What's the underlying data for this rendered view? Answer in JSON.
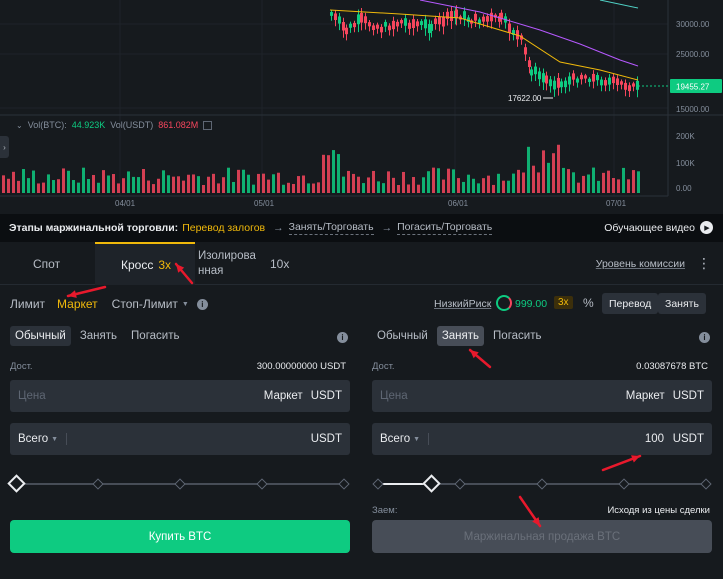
{
  "chart": {
    "price_axis": [
      "30000.00",
      "25000.00",
      "15000.00"
    ],
    "current_price": "19455.27",
    "low_label": "17622.00",
    "volume_axis": [
      "200K",
      "100K",
      "0.00"
    ],
    "date_labels": [
      "04/01",
      "05/01",
      "06/01",
      "07/01"
    ],
    "vol_legend": {
      "label": "Vol(BTC):",
      "btc": "44.923K",
      "usdt_label": "Vol(USDT)",
      "usdt": "861.082M"
    },
    "colors": {
      "up": "#0ecb81",
      "down": "#f6465d",
      "ma_fast": "#f0b90b",
      "ma_slow": "#b659ff"
    }
  },
  "stages": {
    "label": "Этапы маржинальной торговли:",
    "steps": [
      "Перевод залогов",
      "Занять/Торговать",
      "Погасить/Торговать"
    ],
    "video": "Обучающее видео"
  },
  "tabs": {
    "spot": "Спот",
    "cross": "Кросс",
    "cross_leverage": "3x",
    "isolated_line1": "Изолирова",
    "isolated_line2": "нная",
    "isolated_leverage": "10x",
    "fee_level": "Уровень комиссии",
    "more": "⋮"
  },
  "order_types": {
    "limit": "Лимит",
    "market": "Маркет",
    "stop_limit": "Стоп-Лимит",
    "risk": "НизкийРиск",
    "margin_ratio": "999.00",
    "leverage_badge": "3x",
    "transfer": "Перевод",
    "borrow": "Занять"
  },
  "buy_panel": {
    "modes": [
      "Обычный",
      "Занять",
      "Погасить"
    ],
    "available_label": "Дост.",
    "available_value": "300.00000000 USDT",
    "price_placeholder": "Цена",
    "price_market": "Маркет",
    "price_unit": "USDT",
    "total_label": "Всего",
    "total_unit": "USDT",
    "submit": "Купить BTC"
  },
  "sell_panel": {
    "modes": [
      "Обычный",
      "Занять",
      "Погасить"
    ],
    "available_label": "Дост.",
    "available_value": "0.03087678 BTC",
    "price_placeholder": "Цена",
    "price_market": "Маркет",
    "price_unit": "USDT",
    "total_label": "Всего",
    "total_value": "100",
    "total_unit": "USDT",
    "loan_label": "Заем:",
    "loan_source": "Исходя из цены сделки",
    "submit": "Маржинальная продажа BTC"
  },
  "annotation_color": "#e8192c"
}
